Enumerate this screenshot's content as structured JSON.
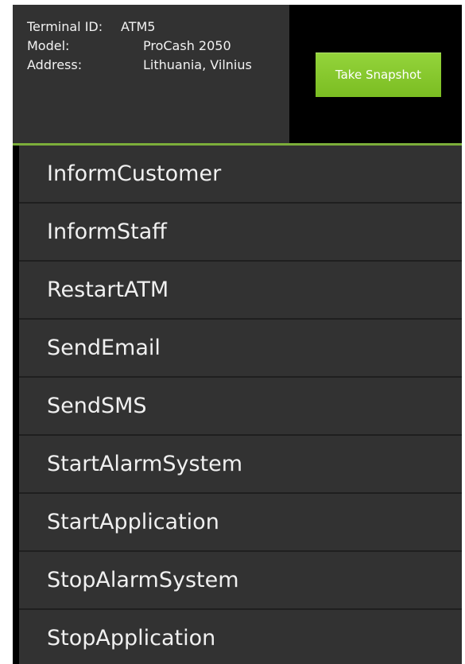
{
  "terminal": {
    "terminal_id_label": "Terminal ID:",
    "terminal_id_value": "ATM5",
    "model_label": "Model:",
    "model_value": "ProCash 2050",
    "address_label": "Address:",
    "address_value": "Lithuania, Vilnius"
  },
  "header": {
    "snapshot_button_label": "Take Snapshot"
  },
  "actions": [
    {
      "label": "InformCustomer"
    },
    {
      "label": "InformStaff"
    },
    {
      "label": "RestartATM"
    },
    {
      "label": "SendEmail"
    },
    {
      "label": "SendSMS"
    },
    {
      "label": "StartAlarmSystem"
    },
    {
      "label": "StartApplication"
    },
    {
      "label": "StopAlarmSystem"
    },
    {
      "label": "StopApplication"
    }
  ],
  "colors": {
    "panel_background": "#323232",
    "screen_background": "#000000",
    "accent_green": "#8dca35",
    "divider_green": "#7cae3a",
    "text": "#f0f0f0"
  }
}
